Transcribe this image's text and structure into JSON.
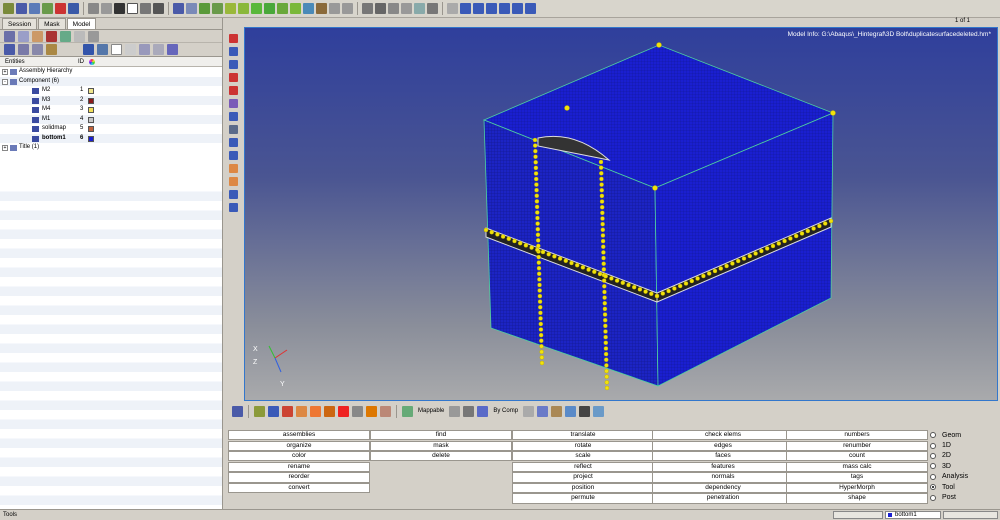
{
  "toolbar": {
    "icons": [
      "model-icon",
      "open-icon",
      "save-icon",
      "import-icon",
      "export-icon",
      "user-icon",
      "hide-icon",
      "show-icon",
      "select-icon",
      "box-icon",
      "window-icon",
      "capture-icon",
      "zoom-icon",
      "zoom-box-icon",
      "pan-icon",
      "rotate-icon",
      "fit-icon",
      "view-iso-icon",
      "view-top-icon",
      "view-front-icon",
      "view-side-icon",
      "view-left-icon",
      "view-back-icon",
      "view-bottom-icon",
      "reset-icon",
      "clip-icon",
      "find-icon",
      "magnify-icon",
      "move-icon",
      "spin-icon",
      "center-icon",
      "tag-icon",
      "undo-icon",
      "layout-1-icon",
      "layout-2-icon",
      "layout-3-icon",
      "layout-4-icon",
      "layout-5-icon",
      "layout-6-icon"
    ]
  },
  "left_panel": {
    "tabs": [
      "Session",
      "Mask",
      "Model"
    ],
    "active_tab": "Model",
    "header": {
      "entities": "Entities",
      "id": "ID"
    },
    "tree": [
      {
        "label": "Assembly Hierarchy",
        "level": 0,
        "expander": "+",
        "id": "",
        "color": ""
      },
      {
        "label": "Component (6)",
        "level": 0,
        "expander": "-",
        "id": "",
        "color": ""
      },
      {
        "label": "M2",
        "level": 1,
        "id": "1",
        "color": "#f0e68c"
      },
      {
        "label": "M3",
        "level": 1,
        "id": "2",
        "color": "#8b1a1a"
      },
      {
        "label": "M4",
        "level": 1,
        "id": "3",
        "color": "#f2e05a"
      },
      {
        "label": "M1",
        "level": 1,
        "id": "4",
        "color": "#c8c8c8"
      },
      {
        "label": "solidmap",
        "level": 1,
        "id": "5",
        "color": "#c0623c"
      },
      {
        "label": "bottom1",
        "level": 1,
        "id": "6",
        "color": "#1a1fd0",
        "bold": true
      },
      {
        "label": "Title (1)",
        "level": 0,
        "expander": "+",
        "id": "",
        "color": ""
      }
    ]
  },
  "viewport": {
    "model_info": "Model Info: G:\\Abaqus\\_Hintegraf\\3D Bolt\\duplicatesurfacedeleted.hm*",
    "page": "1 of 1",
    "axis_labels": {
      "x": "X",
      "y": "Y",
      "z": "Z"
    },
    "mesh_color": "#1a1fd0",
    "highlight_color": "#f2e20a"
  },
  "vp_toolbar": {
    "mappable_label": "Mappable",
    "bycomp_label": "By Comp"
  },
  "menu": {
    "col1": [
      "assemblies",
      "organize",
      "color",
      "rename",
      "reorder",
      "convert"
    ],
    "col2": [
      "find",
      "mask",
      "delete"
    ],
    "col3": [
      "translate",
      "rotate",
      "scale",
      "reflect",
      "project",
      "position",
      "permute"
    ],
    "col4": [
      "check elems",
      "edges",
      "faces",
      "features",
      "normals",
      "dependency",
      "penetration"
    ],
    "col5": [
      "numbers",
      "renumber",
      "count",
      "mass calc",
      "tags",
      "HyperMorph",
      "shape"
    ],
    "radios": [
      {
        "label": "Geom",
        "selected": false
      },
      {
        "label": "1D",
        "selected": false
      },
      {
        "label": "2D",
        "selected": false
      },
      {
        "label": "3D",
        "selected": false
      },
      {
        "label": "Analysis",
        "selected": false
      },
      {
        "label": "Tool",
        "selected": true
      },
      {
        "label": "Post",
        "selected": false
      }
    ]
  },
  "status": {
    "left": "Tools",
    "component": "bottom1"
  }
}
